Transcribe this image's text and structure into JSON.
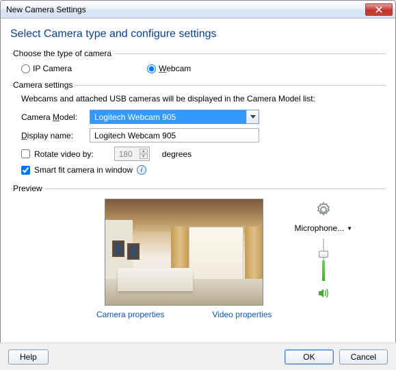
{
  "window": {
    "title": "New Camera Settings"
  },
  "heading": "Select Camera type and configure settings",
  "type_group": {
    "legend": "Choose the type of camera",
    "ip_label": "IP Camera",
    "webcam_label": "Webcam",
    "selected": "webcam"
  },
  "settings_group": {
    "legend": "Camera settings",
    "caption": "Webcams and attached USB cameras will be displayed in the Camera Model list:",
    "model_label": "Camera Model:",
    "model_label_ul": "M",
    "model_value": "Logitech Webcam 905",
    "display_label": "Display name:",
    "display_label_ul": "D",
    "display_value": "Logitech Webcam 905",
    "rotate_label": "Rotate video by:",
    "rotate_checked": false,
    "rotate_value": "180",
    "rotate_unit": "degrees",
    "smartfit_label": "Smart fit camera in window",
    "smartfit_checked": true
  },
  "preview": {
    "legend": "Preview",
    "gear_name": "settings-gear-icon",
    "mic_label": "Microphone...",
    "camera_props": "Camera properties",
    "video_props": "Video properties",
    "slider_value_pct": 52
  },
  "footer": {
    "help": "Help",
    "ok": "OK",
    "cancel": "Cancel"
  }
}
